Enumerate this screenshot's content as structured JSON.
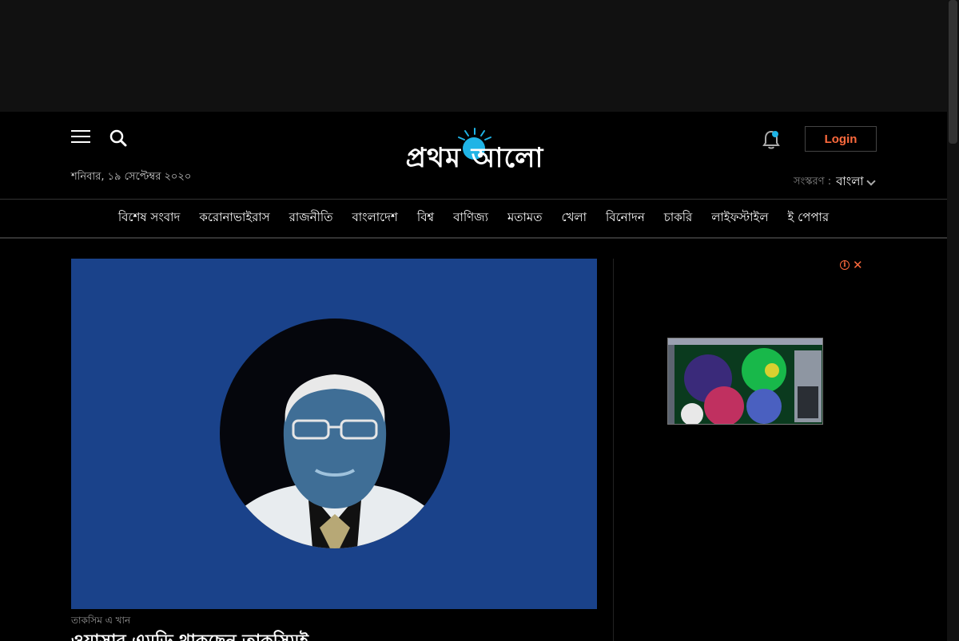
{
  "header": {
    "date": "শনিবার, ১৯ সেপ্টেম্বর ২০২০",
    "logo_text": "প্রথম আলো",
    "login_label": "Login",
    "edition_label": "সংস্করণ :",
    "edition_value": "বাংলা"
  },
  "nav": {
    "items": [
      "বিশেষ সংবাদ",
      "করোনাভাইরাস",
      "রাজনীতি",
      "বাংলাদেশ",
      "বিশ্ব",
      "বাণিজ্য",
      "মতামত",
      "খেলা",
      "বিনোদন",
      "চাকরি",
      "লাইফস্টাইল",
      "ই পেপার"
    ]
  },
  "article": {
    "author": "তাকসিম এ খান",
    "headline": "ওয়াসার এমডি থাকছেন তাকসিমই"
  },
  "colors": {
    "accent": "#ff6a3d",
    "brand_sun": "#1fb4e6",
    "hero_bg": "#1a428a"
  }
}
